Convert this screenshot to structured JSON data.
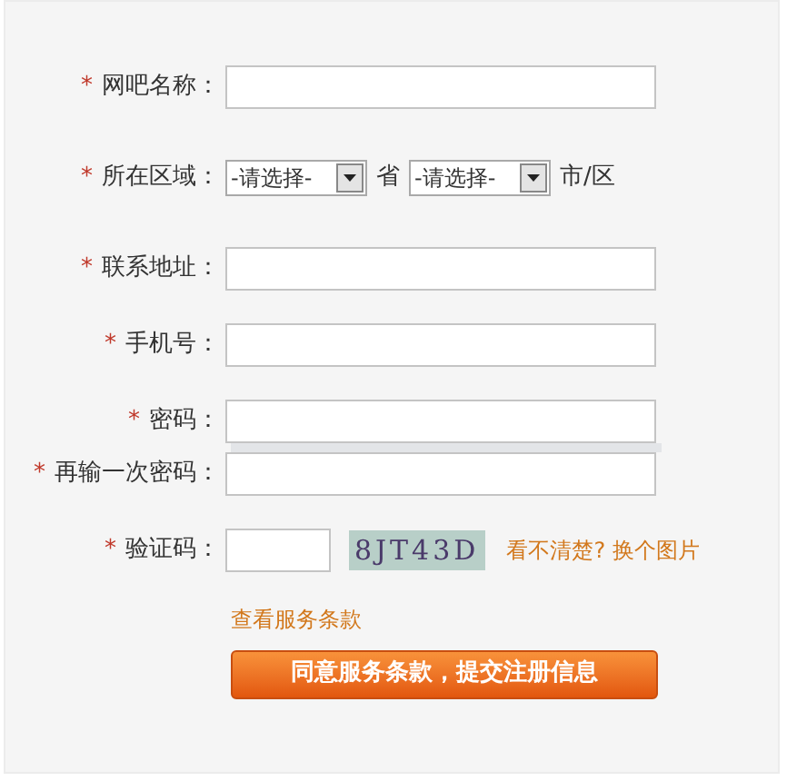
{
  "fields": [
    {
      "kind": "text",
      "required_mark": "*",
      "label": "网吧名称："
    },
    {
      "kind": "region",
      "required_mark": "*",
      "label": "所在区域：",
      "selects": [
        {
          "value": "-请选择-",
          "suffix": "省"
        },
        {
          "value": "-请选择-",
          "suffix": "市/区"
        }
      ]
    },
    {
      "kind": "text",
      "required_mark": "*",
      "label": "联系地址："
    },
    {
      "kind": "text",
      "required_mark": "*",
      "label": "手机号："
    },
    {
      "kind": "text",
      "required_mark": "*",
      "label": "密码："
    },
    {
      "kind": "meter"
    },
    {
      "kind": "text",
      "required_mark": "*",
      "label": "再输一次密码："
    },
    {
      "kind": "captcha",
      "required_mark": "*",
      "label": "验证码：",
      "captcha_text": "8JT43D",
      "refresh_link": "看不清楚? 换个图片"
    }
  ],
  "terms_link": "查看服务条款",
  "submit_button": "同意服务条款，提交注册信息"
}
